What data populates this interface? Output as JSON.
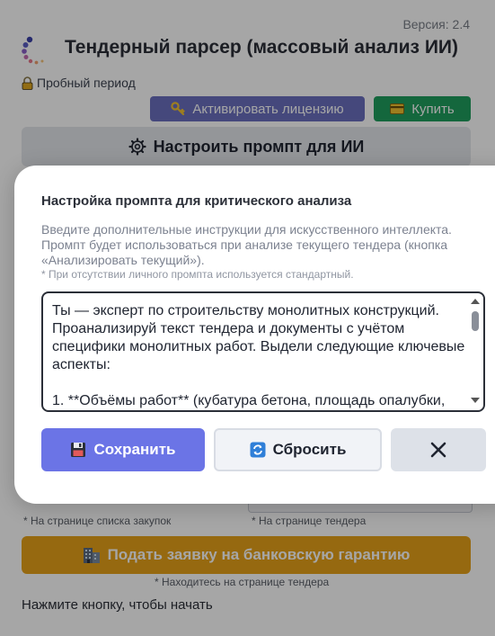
{
  "header": {
    "version": "Версия: 2.4",
    "title": "Тендерный парсер (массовый анализ ИИ)",
    "trial": "Пробный период"
  },
  "buttons": {
    "activate": "Активировать лицензию",
    "buy": "Купить",
    "configure_prompt": "Настроить промпт для ИИ",
    "guarantee": "Подать заявку на банковскую гарантию"
  },
  "notes": {
    "list_page": "* На странице списка закупок",
    "tender_page": "* На странице тендера",
    "guarantee_note": "* Находитесь на странице тендера",
    "start": "Нажмите кнопку, чтобы начать"
  },
  "modal": {
    "title": "Настройка промпта для критического анализа",
    "description": "Введите дополнительные инструкции для искусственного интеллекта. Промпт будет использоваться при анализе текущего тендера (кнопка «Анализировать текущий»).",
    "note": "* При отсутствии личного промпта используется стандартный.",
    "prompt_text": "Ты — эксперт по строительству монолитных конструкций. Проанализируй текст тендера и документы с учётом специфики монолитных работ. Выдели следующие ключевые аспекты:\n\n1. **Объёмы работ** (кубатура бетона, площадь опалубки, тоннаж арматуры). Если объёмы не указаны, оцени их",
    "save": "Сохранить",
    "reset": "Сбросить"
  },
  "colors": {
    "activate": "#6b6fbf",
    "buy": "#1f9e5e",
    "guarantee": "#e6a21a",
    "save": "#6b74e6"
  }
}
